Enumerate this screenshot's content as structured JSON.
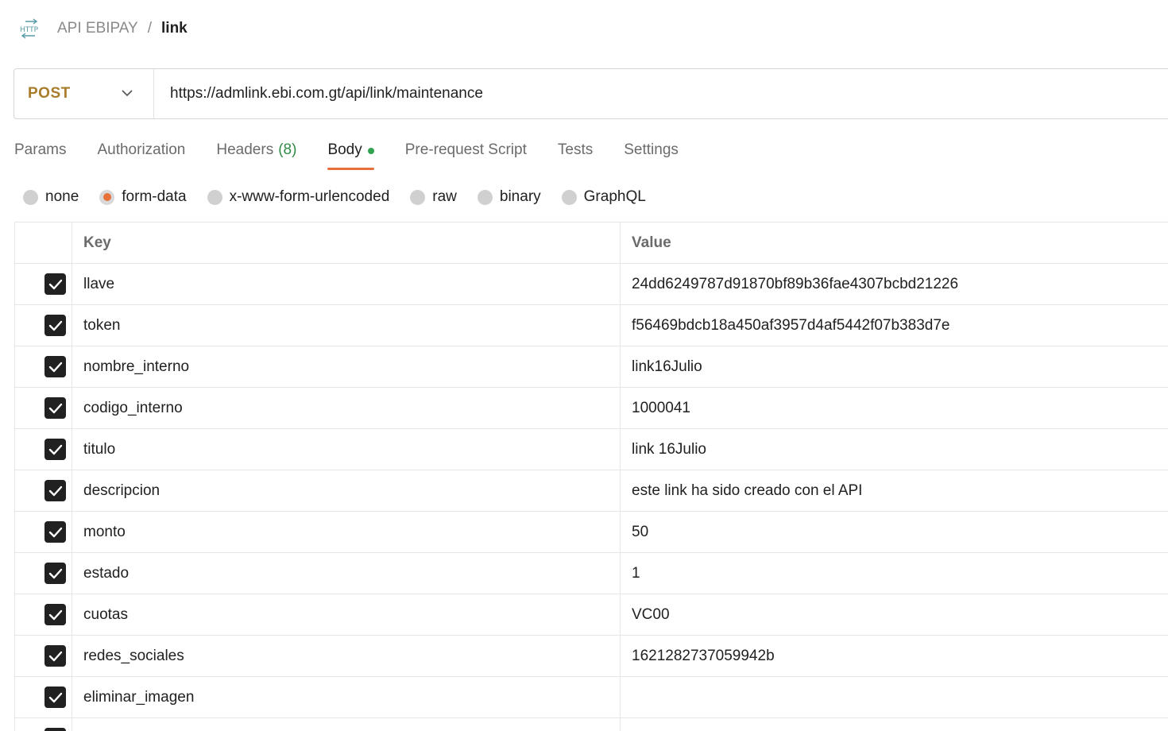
{
  "header": {
    "icon": "http-swap-icon",
    "collection": "API EBIPAY",
    "separator": "/",
    "request_name": "link"
  },
  "request": {
    "method": "POST",
    "url": "https://admlink.ebi.com.gt/api/link/maintenance"
  },
  "tabs": [
    {
      "label": "Params"
    },
    {
      "label": "Authorization"
    },
    {
      "label": "Headers",
      "count": "(8)"
    },
    {
      "label": "Body",
      "active": true
    },
    {
      "label": "Pre-request Script"
    },
    {
      "label": "Tests"
    },
    {
      "label": "Settings"
    }
  ],
  "body_types": [
    {
      "label": "none"
    },
    {
      "label": "form-data",
      "selected": true
    },
    {
      "label": "x-www-form-urlencoded"
    },
    {
      "label": "raw"
    },
    {
      "label": "binary"
    },
    {
      "label": "GraphQL"
    }
  ],
  "table": {
    "headers": {
      "key": "Key",
      "value": "Value"
    },
    "rows": [
      {
        "key": "llave",
        "value": "24dd6249787d91870bf89b36fae4307bcbd21226",
        "checked": true
      },
      {
        "key": "token",
        "value": "f56469bdcb18a450af3957d4af5442f07b383d7e",
        "checked": true
      },
      {
        "key": "nombre_interno",
        "value": "link16Julio",
        "checked": true
      },
      {
        "key": "codigo_interno",
        "value": "1000041",
        "checked": true
      },
      {
        "key": "titulo",
        "value": "link 16Julio",
        "checked": true
      },
      {
        "key": "descripcion",
        "value": "este link ha sido creado con el API",
        "checked": true
      },
      {
        "key": "monto",
        "value": "50",
        "checked": true
      },
      {
        "key": "estado",
        "value": "1",
        "checked": true
      },
      {
        "key": "cuotas",
        "value": "VC00",
        "checked": true
      },
      {
        "key": "redes_sociales",
        "value": "1621282737059942b",
        "checked": true
      },
      {
        "key": "eliminar_imagen",
        "value": "",
        "checked": true
      },
      {
        "key": "",
        "value": "",
        "checked": true
      }
    ]
  },
  "colors": {
    "method": "#a97c2b",
    "active_tab_underline": "#e8703a",
    "body_dot": "#2fa34e",
    "headers_count": "#2f8a45",
    "radio_selected": "#e8703a",
    "checkbox": "#212121"
  }
}
